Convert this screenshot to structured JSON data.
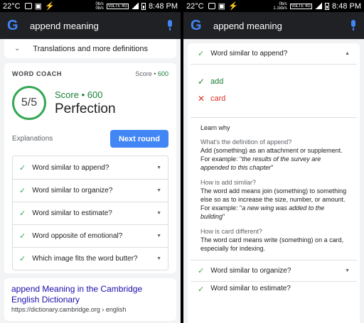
{
  "status": {
    "temperature": "22°C",
    "speed_top": "0b/s",
    "speed_bottom": "0b/s",
    "speed_top_right": "0b/s",
    "speed_bottom_right": "1.1kb/s",
    "network": "VoLTE 4G",
    "time": "8:48 PM"
  },
  "search": {
    "logo": "G",
    "query": "append meaning"
  },
  "left": {
    "translations_label": "Translations and more definitions",
    "coach": {
      "title": "WORD COACH",
      "score_label": "Score •",
      "score_value": "600",
      "fraction": "5/5",
      "score_line": "Score • 600",
      "headline": "Perfection",
      "explanations_label": "Explanations",
      "next_round_label": "Next round",
      "questions": [
        "Word similar to append?",
        "Word similar to organize?",
        "Word similar to estimate?",
        "Word opposite of emotional?",
        "Which image fits the word butter?"
      ]
    },
    "result": {
      "title": "append Meaning in the Cambridge English Dictionary",
      "url": "https://dictionary.cambridge.org › english"
    }
  },
  "right": {
    "question": "Word similar to append?",
    "answers": [
      {
        "mark": "✓",
        "text": "add"
      },
      {
        "mark": "✕",
        "text": "card"
      }
    ],
    "learn_why": "Learn why",
    "sections": [
      {
        "q": "What's the definition of append?",
        "a": "Add (something) as an attachment or supplement.",
        "ex_prefix": "For example: \"",
        "ex": "the results of the survey are appended to this chapter",
        "ex_suffix": "\""
      },
      {
        "q": "How is add similar?",
        "a": "The word add means join (something) to something else so as to increase the size, number, or amount.",
        "ex_prefix": "For example: \"",
        "ex": "a new wing was added to the building",
        "ex_suffix": "\""
      },
      {
        "q": "How is card different?",
        "a": "The word card means write (something) on a card, especially for indexing."
      }
    ],
    "next_question": "Word similar to organize?",
    "next_question_2": "Word similar to estimate?"
  }
}
